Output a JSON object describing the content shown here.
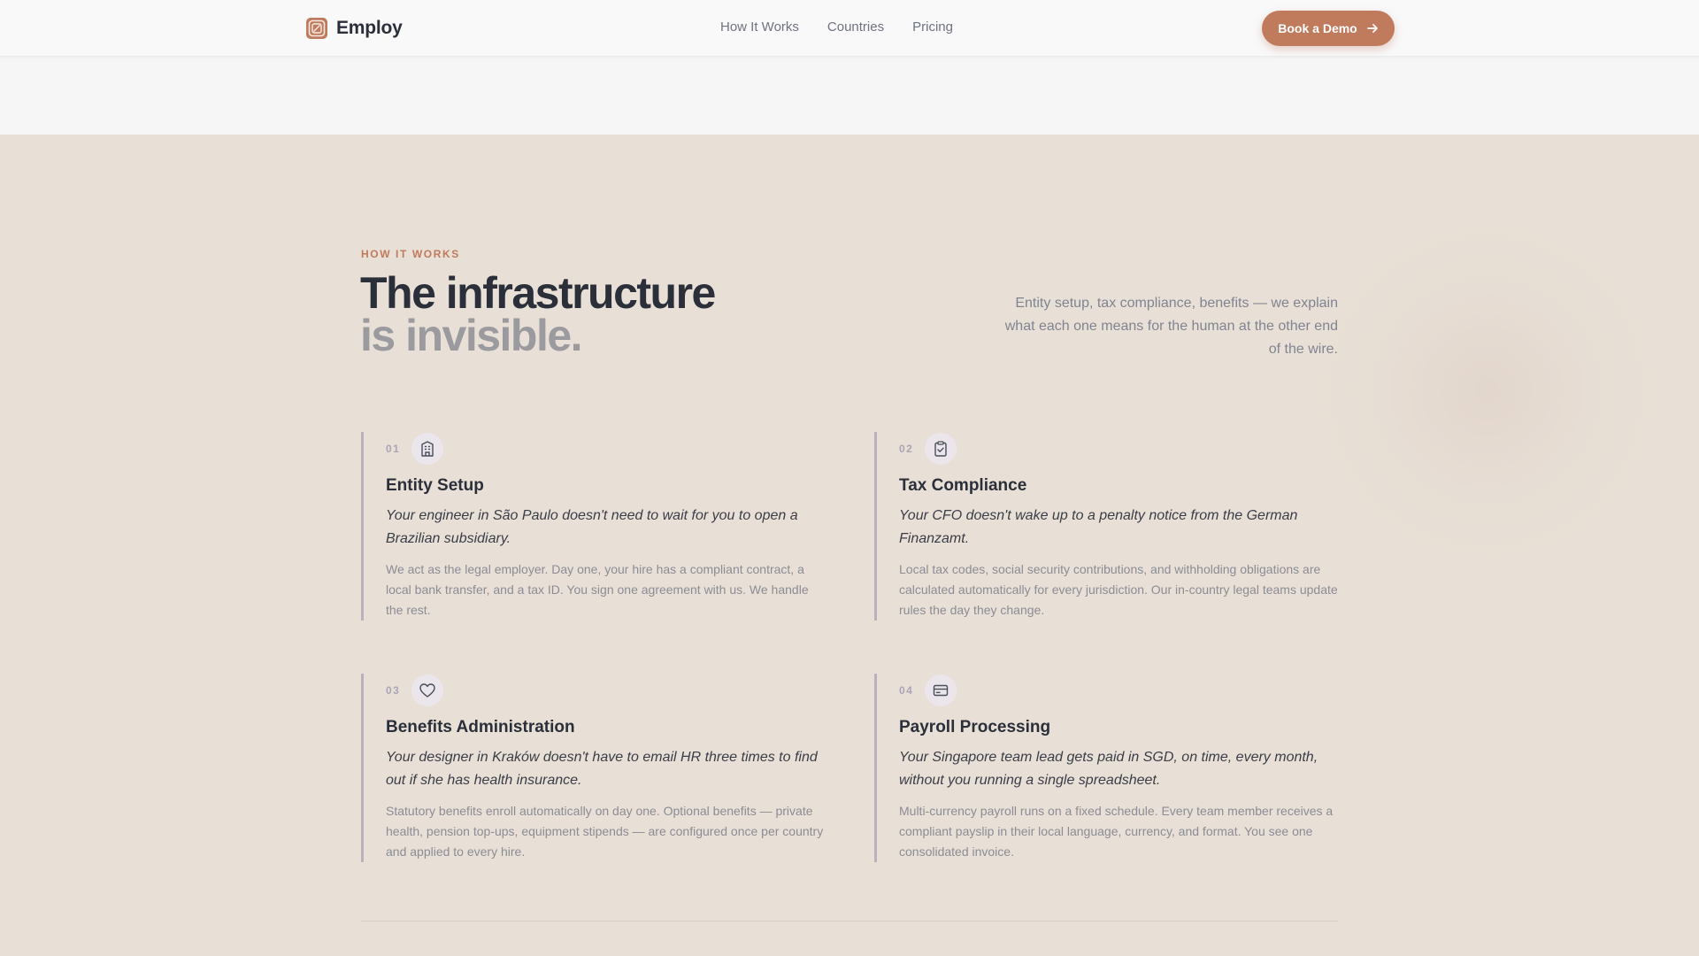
{
  "nav": {
    "brand": "Employ",
    "links": [
      "How It Works",
      "Countries",
      "Pricing"
    ],
    "cta_label": "Book a Demo"
  },
  "section": {
    "eyebrow": "HOW IT WORKS",
    "headline_line1": "The infrastructure",
    "headline_line2": "is invisible.",
    "intro": "Entity setup, tax compliance, benefits — we explain what each one means for the human at the other end of the wire."
  },
  "cards": [
    {
      "num": "01",
      "icon": "building-icon",
      "title": "Entity Setup",
      "quote": "Your engineer in São Paulo doesn't need to wait for you to open a Brazilian subsidiary.",
      "body": "We act as the legal employer. Day one, your hire has a compliant contract, a local bank transfer, and a tax ID. You sign one agreement with us. We handle the rest."
    },
    {
      "num": "02",
      "icon": "clipboard-check-icon",
      "title": "Tax Compliance",
      "quote": "Your CFO doesn't wake up to a penalty notice from the German Finanzamt.",
      "body": "Local tax codes, social security contributions, and withholding obligations are calculated automatically for every jurisdiction. Our in-country legal teams update rules the day they change."
    },
    {
      "num": "03",
      "icon": "heart-icon",
      "title": "Benefits Administration",
      "quote": "Your designer in Kraków doesn't have to email HR three times to find out if she has health insurance.",
      "body": "Statutory benefits enroll automatically on day one. Optional benefits — private health, pension top-ups, equipment stipends — are configured once per country and applied to every hire."
    },
    {
      "num": "04",
      "icon": "credit-card-icon",
      "title": "Payroll Processing",
      "quote": "Your Singapore team lead gets paid in SGD, on time, every month, without you running a single spreadsheet.",
      "body": "Multi-currency payroll runs on a fixed schedule. Every team member receives a compliant payslip in their local language, currency, and format. You see one consolidated invoice."
    }
  ],
  "colors": {
    "accent": "#c07a5c",
    "section_bg": "#e8e0d6",
    "nav_bg": "#f9f9fa",
    "heading": "#2b2f3a",
    "muted_heading": "#9a9a9f"
  }
}
